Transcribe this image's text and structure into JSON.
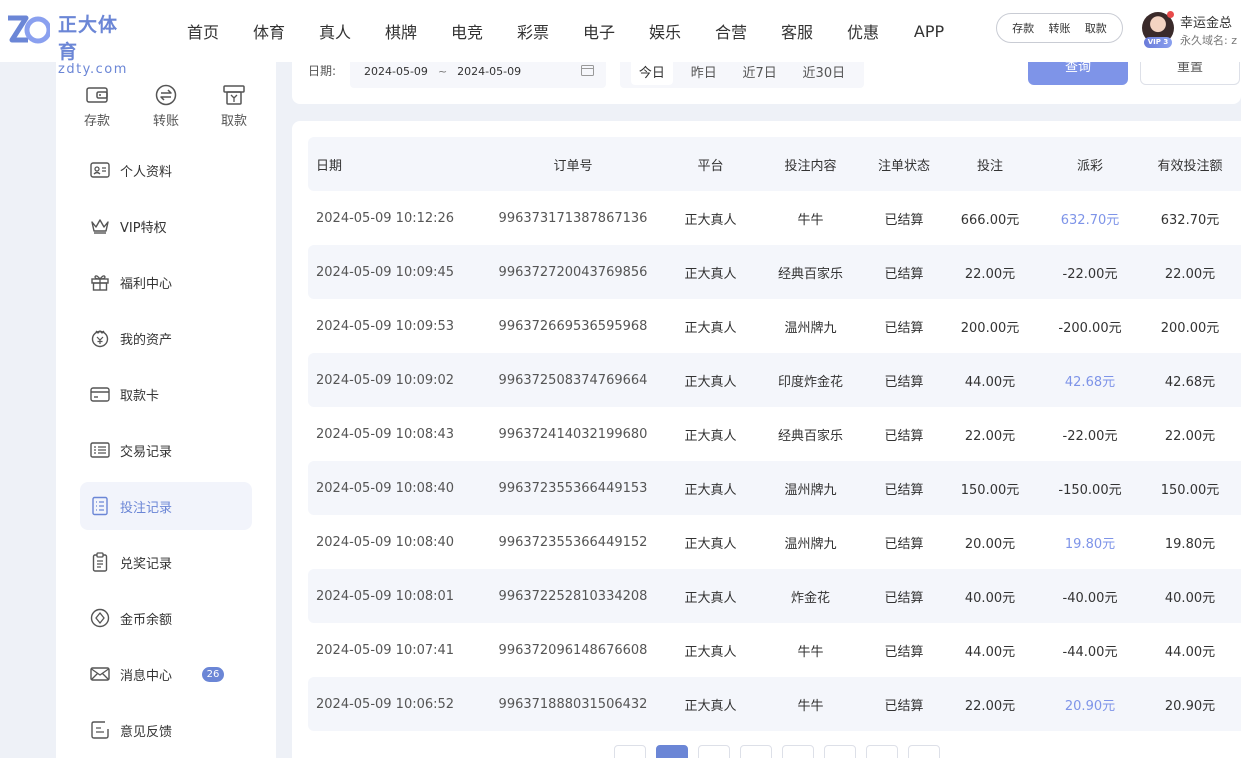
{
  "brand": {
    "name_cn": "正大体育",
    "domain": "zdty.com"
  },
  "nav": [
    "首页",
    "体育",
    "真人",
    "棋牌",
    "电竞",
    "彩票",
    "电子",
    "娱乐",
    "合营",
    "客服",
    "优惠",
    "APP"
  ],
  "quick_links": {
    "deposit": "存款",
    "transfer": "转账",
    "withdraw": "取款"
  },
  "user": {
    "name": "幸运金总",
    "vip": "VIP 3",
    "domain_label": "永久域名: z"
  },
  "sidebar": {
    "quick_actions": [
      {
        "label": "存款",
        "icon": "wallet-icon"
      },
      {
        "label": "转账",
        "icon": "transfer-icon"
      },
      {
        "label": "取款",
        "icon": "withdraw-icon"
      }
    ],
    "items": [
      {
        "label": "个人资料",
        "icon": "id-card-icon"
      },
      {
        "label": "VIP特权",
        "icon": "crown-icon"
      },
      {
        "label": "福利中心",
        "icon": "gift-icon"
      },
      {
        "label": "我的资产",
        "icon": "assets-icon"
      },
      {
        "label": "取款卡",
        "icon": "bank-card-icon"
      },
      {
        "label": "交易记录",
        "icon": "transaction-icon"
      },
      {
        "label": "投注记录",
        "icon": "bet-record-icon",
        "active": true
      },
      {
        "label": "兑奖记录",
        "icon": "clipboard-icon"
      },
      {
        "label": "金币余额",
        "icon": "coin-icon"
      },
      {
        "label": "消息中心",
        "icon": "mail-icon",
        "badge": "26"
      },
      {
        "label": "意见反馈",
        "icon": "feedback-icon"
      }
    ]
  },
  "filter": {
    "label": "日期:",
    "date_from": "2024-05-09",
    "separator": "~",
    "date_to": "2024-05-09",
    "ranges": [
      "今日",
      "昨日",
      "近7日",
      "近30日"
    ],
    "active_range": "今日",
    "query_label": "查询",
    "reset_label": "重置"
  },
  "table": {
    "columns": [
      "日期",
      "订单号",
      "平台",
      "投注内容",
      "注单状态",
      "投注",
      "派彩",
      "有效投注额"
    ],
    "rows": [
      {
        "date": "2024-05-09 10:12:26",
        "order": "996373171387867136",
        "platform": "正大真人",
        "content": "牛牛",
        "status": "已结算",
        "bet": "666.00元",
        "payout": "632.70元",
        "valid": "632.70元",
        "win": true
      },
      {
        "date": "2024-05-09 10:09:45",
        "order": "996372720043769856",
        "platform": "正大真人",
        "content": "经典百家乐",
        "status": "已结算",
        "bet": "22.00元",
        "payout": "-22.00元",
        "valid": "22.00元",
        "win": false
      },
      {
        "date": "2024-05-09 10:09:53",
        "order": "996372669536595968",
        "platform": "正大真人",
        "content": "温州牌九",
        "status": "已结算",
        "bet": "200.00元",
        "payout": "-200.00元",
        "valid": "200.00元",
        "win": false
      },
      {
        "date": "2024-05-09 10:09:02",
        "order": "996372508374769664",
        "platform": "正大真人",
        "content": "印度炸金花",
        "status": "已结算",
        "bet": "44.00元",
        "payout": "42.68元",
        "valid": "42.68元",
        "win": true
      },
      {
        "date": "2024-05-09 10:08:43",
        "order": "996372414032199680",
        "platform": "正大真人",
        "content": "经典百家乐",
        "status": "已结算",
        "bet": "22.00元",
        "payout": "-22.00元",
        "valid": "22.00元",
        "win": false
      },
      {
        "date": "2024-05-09 10:08:40",
        "order": "996372355366449153",
        "platform": "正大真人",
        "content": "温州牌九",
        "status": "已结算",
        "bet": "150.00元",
        "payout": "-150.00元",
        "valid": "150.00元",
        "win": false
      },
      {
        "date": "2024-05-09 10:08:40",
        "order": "996372355366449152",
        "platform": "正大真人",
        "content": "温州牌九",
        "status": "已结算",
        "bet": "20.00元",
        "payout": "19.80元",
        "valid": "19.80元",
        "win": true
      },
      {
        "date": "2024-05-09 10:08:01",
        "order": "996372252810334208",
        "platform": "正大真人",
        "content": "炸金花",
        "status": "已结算",
        "bet": "40.00元",
        "payout": "-40.00元",
        "valid": "40.00元",
        "win": false
      },
      {
        "date": "2024-05-09 10:07:41",
        "order": "996372096148676608",
        "platform": "正大真人",
        "content": "牛牛",
        "status": "已结算",
        "bet": "44.00元",
        "payout": "-44.00元",
        "valid": "44.00元",
        "win": false
      },
      {
        "date": "2024-05-09 10:06:52",
        "order": "996371888031506432",
        "platform": "正大真人",
        "content": "牛牛",
        "status": "已结算",
        "bet": "22.00元",
        "payout": "20.90元",
        "valid": "20.90元",
        "win": true
      }
    ]
  },
  "colors": {
    "accent": "#6b86d6",
    "win": "#7e94e8",
    "bg": "#eef1f7"
  }
}
